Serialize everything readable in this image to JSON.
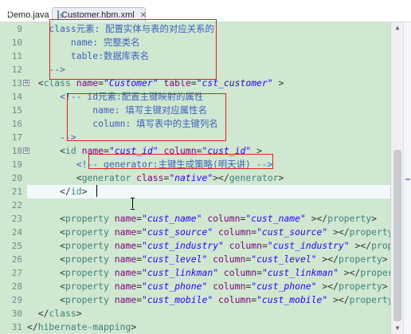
{
  "tabs": [
    {
      "label": "Demo.java",
      "icon": "java-file-icon",
      "active": false
    },
    {
      "label": "Customer.hbm.xml",
      "icon": "xml-file-icon",
      "active": true,
      "close": "✕"
    }
  ],
  "editor": {
    "lines": [
      {
        "n": "9",
        "code": [
          [
            "c-com",
            "    class元素: 配置实体与表的对应关系的"
          ]
        ]
      },
      {
        "n": "10",
        "code": [
          [
            "c-com",
            "        name: 完整类名"
          ]
        ]
      },
      {
        "n": "11",
        "code": [
          [
            "c-com",
            "        table:数据库表名"
          ]
        ]
      },
      {
        "n": "12",
        "code": [
          [
            "c-com",
            "    -->"
          ]
        ]
      },
      {
        "n": "13",
        "code": [
          [
            "c-pun",
            "  <"
          ],
          [
            "c-tag",
            "class "
          ],
          [
            "c-attr",
            "name"
          ],
          [
            "c-pun",
            "="
          ],
          [
            "c-val",
            "\"Customer\""
          ],
          [
            "c-attr",
            " table"
          ],
          [
            "c-pun",
            "="
          ],
          [
            "c-val",
            "\"cst_customer\""
          ],
          [
            "c-pun",
            " >"
          ]
        ]
      },
      {
        "n": "14",
        "code": [
          [
            "c-com",
            "      <!-- id元素:配置主键映射的属性"
          ]
        ]
      },
      {
        "n": "15",
        "code": [
          [
            "c-com",
            "            name: 填写主键对应属性名"
          ]
        ]
      },
      {
        "n": "16",
        "code": [
          [
            "c-com",
            "            column: 填写表中的主键列名"
          ]
        ]
      },
      {
        "n": "17",
        "code": [
          [
            "c-com",
            "      -->"
          ]
        ]
      },
      {
        "n": "18",
        "code": [
          [
            "c-pun",
            "      <"
          ],
          [
            "c-tag",
            "id "
          ],
          [
            "c-attr",
            "name"
          ],
          [
            "c-pun",
            "="
          ],
          [
            "c-val",
            "\"cust_id\""
          ],
          [
            "c-attr",
            " column"
          ],
          [
            "c-pun",
            "="
          ],
          [
            "c-val",
            "\"cust_id\""
          ],
          [
            "c-pun",
            " >"
          ]
        ]
      },
      {
        "n": "19",
        "code": [
          [
            "c-com",
            "         <!-- generator:主键生成策略(明天讲) -->"
          ]
        ]
      },
      {
        "n": "20",
        "code": [
          [
            "c-pun",
            "         <"
          ],
          [
            "c-tag",
            "generator "
          ],
          [
            "c-attr",
            "class"
          ],
          [
            "c-pun",
            "="
          ],
          [
            "c-val",
            "\"native\""
          ],
          [
            "c-pun",
            "></"
          ],
          [
            "c-tag",
            "generator"
          ],
          [
            "c-pun",
            ">"
          ]
        ]
      },
      {
        "n": "21",
        "code": [
          [
            "c-pun",
            "      </"
          ],
          [
            "c-tag",
            "id"
          ],
          [
            "c-pun",
            ">"
          ]
        ]
      },
      {
        "n": "22",
        "code": []
      },
      {
        "n": "23",
        "code": [
          [
            "c-pun",
            "      <"
          ],
          [
            "c-tag",
            "property "
          ],
          [
            "c-attr",
            "name"
          ],
          [
            "c-pun",
            "="
          ],
          [
            "c-val",
            "\"cust_name\""
          ],
          [
            "c-attr",
            " column"
          ],
          [
            "c-pun",
            "="
          ],
          [
            "c-val",
            "\"cust_name\""
          ],
          [
            "c-pun",
            " ></"
          ],
          [
            "c-tag",
            "property"
          ],
          [
            "c-pun",
            ">"
          ]
        ]
      },
      {
        "n": "24",
        "code": [
          [
            "c-pun",
            "      <"
          ],
          [
            "c-tag",
            "property "
          ],
          [
            "c-attr",
            "name"
          ],
          [
            "c-pun",
            "="
          ],
          [
            "c-val",
            "\"cust_source\""
          ],
          [
            "c-attr",
            " column"
          ],
          [
            "c-pun",
            "="
          ],
          [
            "c-val",
            "\"cust_source\""
          ],
          [
            "c-pun",
            " ></"
          ],
          [
            "c-tag",
            "property"
          ],
          [
            "c-pun",
            ">"
          ]
        ]
      },
      {
        "n": "25",
        "code": [
          [
            "c-pun",
            "      <"
          ],
          [
            "c-tag",
            "property "
          ],
          [
            "c-attr",
            "name"
          ],
          [
            "c-pun",
            "="
          ],
          [
            "c-val",
            "\"cust_industry\""
          ],
          [
            "c-attr",
            " column"
          ],
          [
            "c-pun",
            "="
          ],
          [
            "c-val",
            "\"cust_industry\""
          ],
          [
            "c-pun",
            " ></"
          ],
          [
            "c-tag",
            "property"
          ],
          [
            "c-pun",
            ">"
          ]
        ]
      },
      {
        "n": "26",
        "code": [
          [
            "c-pun",
            "      <"
          ],
          [
            "c-tag",
            "property "
          ],
          [
            "c-attr",
            "name"
          ],
          [
            "c-pun",
            "="
          ],
          [
            "c-val",
            "\"cust_level\""
          ],
          [
            "c-attr",
            " column"
          ],
          [
            "c-pun",
            "="
          ],
          [
            "c-val",
            "\"cust_level\""
          ],
          [
            "c-pun",
            " ></"
          ],
          [
            "c-tag",
            "property"
          ],
          [
            "c-pun",
            ">"
          ]
        ]
      },
      {
        "n": "27",
        "code": [
          [
            "c-pun",
            "      <"
          ],
          [
            "c-tag",
            "property "
          ],
          [
            "c-attr",
            "name"
          ],
          [
            "c-pun",
            "="
          ],
          [
            "c-val",
            "\"cust_linkman\""
          ],
          [
            "c-attr",
            " column"
          ],
          [
            "c-pun",
            "="
          ],
          [
            "c-val",
            "\"cust_linkman\""
          ],
          [
            "c-pun",
            " ></"
          ],
          [
            "c-tag",
            "propert"
          ]
        ]
      },
      {
        "n": "28",
        "code": [
          [
            "c-pun",
            "      <"
          ],
          [
            "c-tag",
            "property "
          ],
          [
            "c-attr",
            "name"
          ],
          [
            "c-pun",
            "="
          ],
          [
            "c-val",
            "\"cust_phone\""
          ],
          [
            "c-attr",
            " column"
          ],
          [
            "c-pun",
            "="
          ],
          [
            "c-val",
            "\"cust_phone\""
          ],
          [
            "c-pun",
            " ></"
          ],
          [
            "c-tag",
            "property"
          ],
          [
            "c-pun",
            ">"
          ]
        ]
      },
      {
        "n": "29",
        "code": [
          [
            "c-pun",
            "      <"
          ],
          [
            "c-tag",
            "property "
          ],
          [
            "c-attr",
            "name"
          ],
          [
            "c-pun",
            "="
          ],
          [
            "c-val",
            "\"cust_mobile\""
          ],
          [
            "c-attr",
            " column"
          ],
          [
            "c-pun",
            "="
          ],
          [
            "c-val",
            "\"cust_mobile\""
          ],
          [
            "c-pun",
            " ></"
          ],
          [
            "c-tag",
            "property"
          ]
        ]
      },
      {
        "n": "30",
        "code": [
          [
            "c-pun",
            "  </"
          ],
          [
            "c-tag",
            "class"
          ],
          [
            "c-pun",
            ">"
          ]
        ]
      },
      {
        "n": "31",
        "code": [
          [
            "c-pun",
            "</"
          ],
          [
            "c-tag",
            "hibernate-mapping"
          ],
          [
            "c-pun",
            ">"
          ]
        ]
      }
    ],
    "folds": [
      {
        "line": "13",
        "symbol": "⊖"
      },
      {
        "line": "18",
        "symbol": "⊖"
      }
    ],
    "current_line": "21"
  },
  "colors": {
    "editor_bg": "#cfe8cf",
    "comment": "#3f5fbf",
    "tag": "#3f7f7f",
    "attribute": "#7f007f",
    "value": "#2a00ff",
    "annotation_box": "#e02020"
  }
}
